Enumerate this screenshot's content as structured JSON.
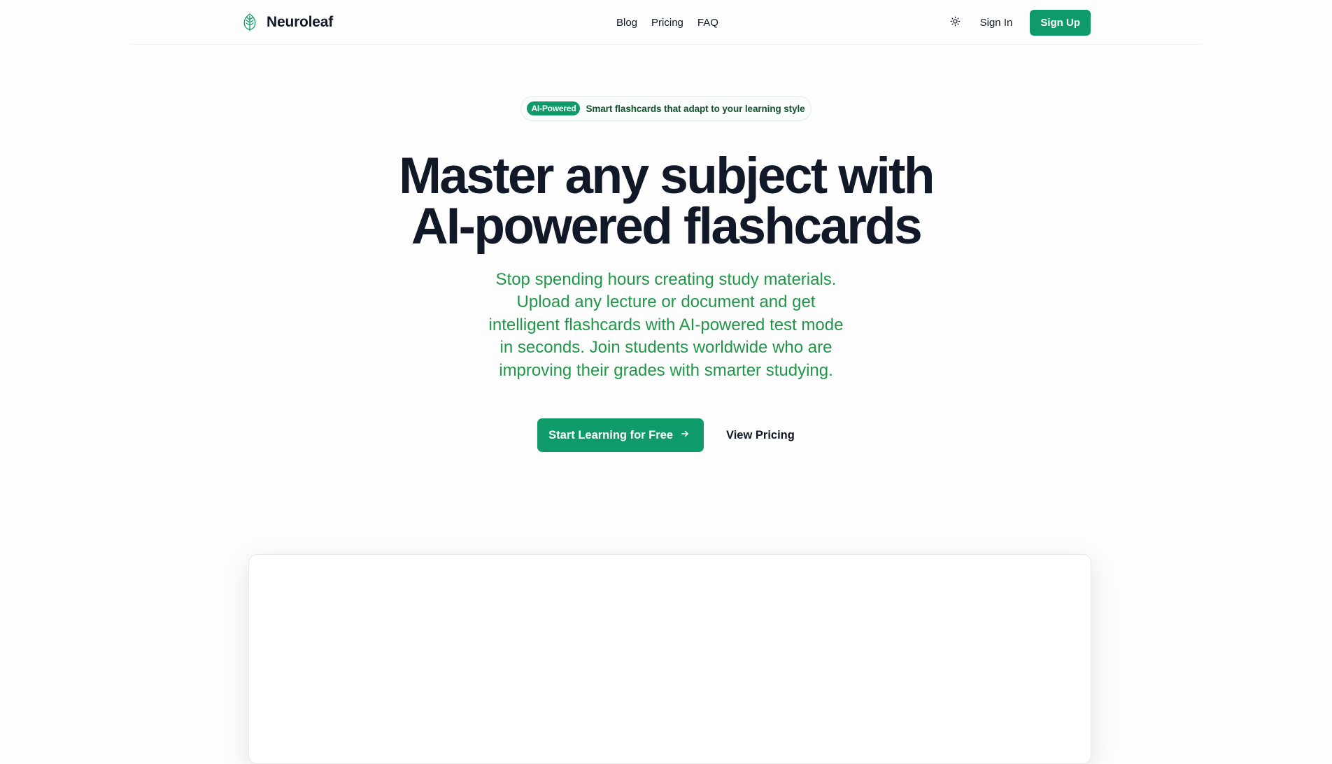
{
  "brand": {
    "name": "Neuroleaf",
    "logo_icon": "leaf-icon",
    "accent_color": "#0f9a6a"
  },
  "nav": {
    "links": [
      {
        "label": "Blog"
      },
      {
        "label": "Pricing"
      },
      {
        "label": "FAQ"
      }
    ],
    "theme_icon": "sun-icon",
    "sign_in": "Sign In",
    "sign_up": "Sign Up"
  },
  "hero": {
    "badge_pill": "AI-Powered",
    "badge_text": "Smart flashcards that adapt to your learning style",
    "headline_line1": "Master any subject with",
    "headline_line2": "AI-powered flashcards",
    "subtext": "Stop spending hours creating study materials. Upload any lecture or document and get intelligent flashcards with AI-powered test mode in seconds. Join students worldwide who are improving their grades with smarter studying.",
    "subtext_color": "#1f9747",
    "cta_primary": "Start Learning for Free",
    "cta_primary_icon": "arrow-right-icon",
    "cta_secondary": "View Pricing"
  }
}
